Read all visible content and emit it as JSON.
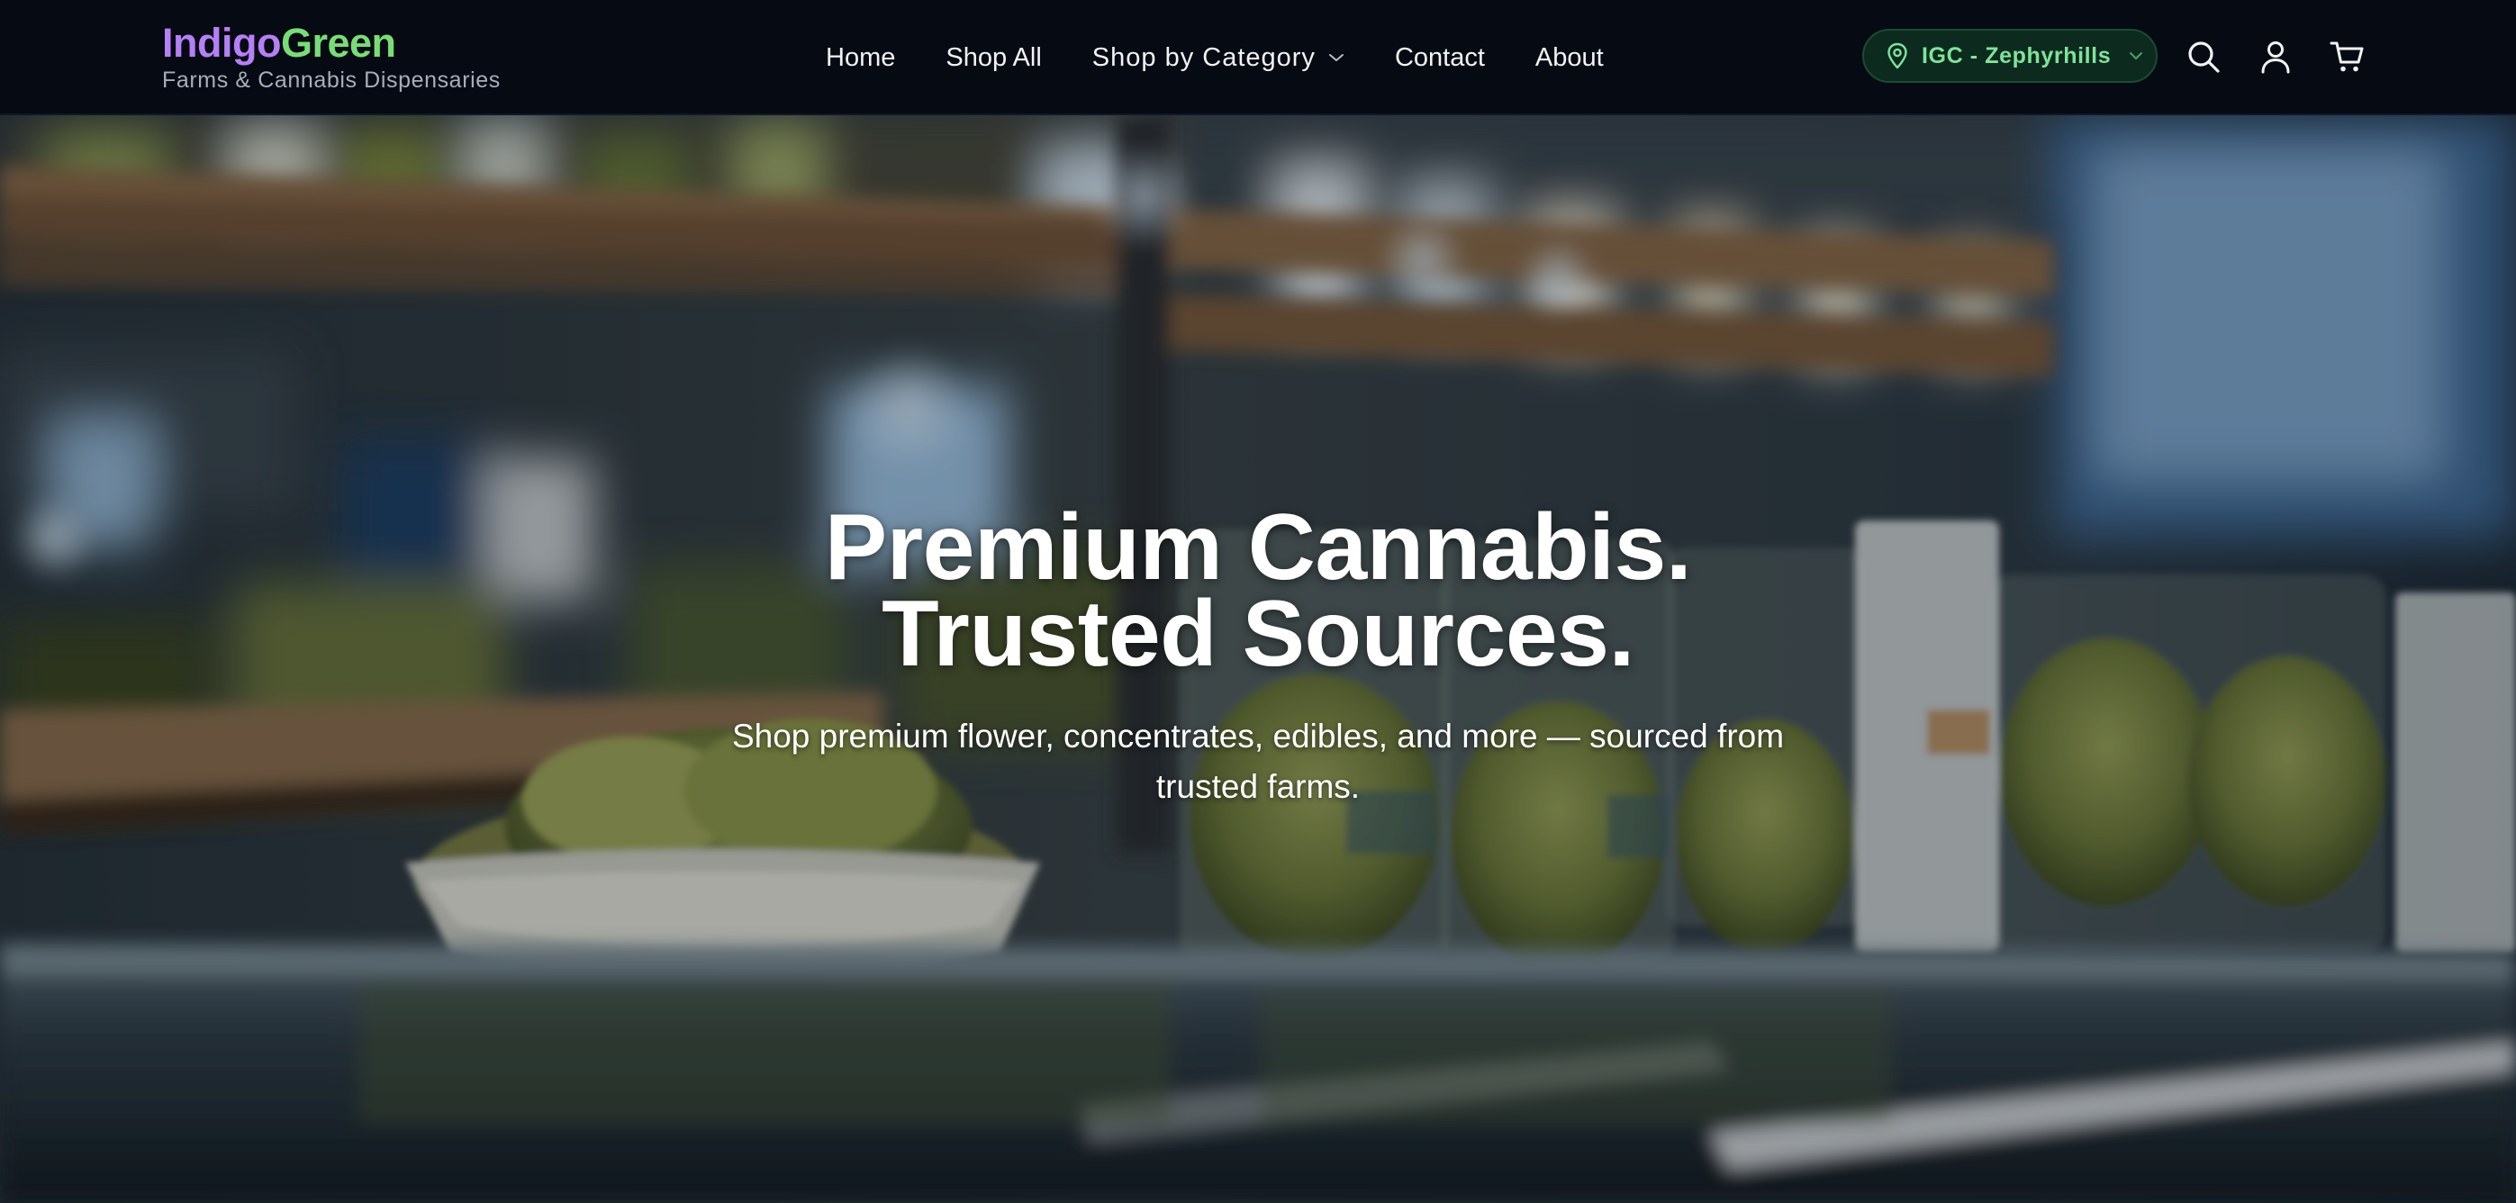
{
  "brand": {
    "name_part1": "Indigo",
    "name_part2": "Green",
    "tagline": "Farms & Cannabis Dispensaries",
    "color_indigo": "#b57ff5",
    "color_green": "#79dd77"
  },
  "nav": {
    "items": [
      {
        "label": "Home"
      },
      {
        "label": "Shop All"
      },
      {
        "label": "Shop by Category",
        "icon": "chevron-down-icon"
      },
      {
        "label": "Contact"
      },
      {
        "label": "About"
      }
    ]
  },
  "location": {
    "label": "IGC - Zephyrhills",
    "icon": "map-pin-icon",
    "accent": "#7fe39a"
  },
  "header_icons": [
    "search-icon",
    "account-icon",
    "cart-icon"
  ],
  "hero": {
    "title_line1": "Premium Cannabis.",
    "title_line2": "Trusted Sources.",
    "subtitle": "Shop premium flower, concentrates, edibles, and more — sourced from trusted farms."
  },
  "colors": {
    "header_bg": "#060a12",
    "pill_bg": "#0d2a1e"
  }
}
